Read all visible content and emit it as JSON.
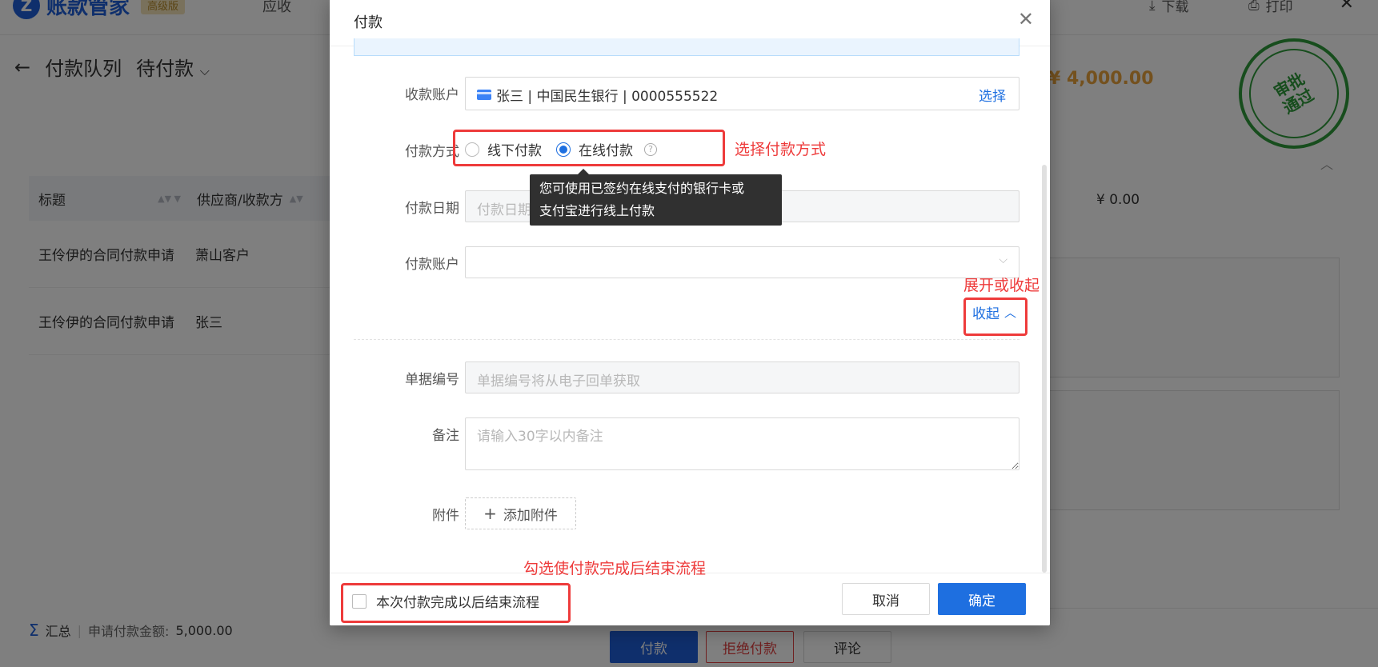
{
  "app": {
    "brand_name": "账款管家",
    "brand_badge": "高级版",
    "nav_item": "应收",
    "download_label": "下载",
    "print_label": "打印"
  },
  "page": {
    "crumb": "付款队列",
    "status_dropdown": "待付款",
    "amount": "¥ 4,000.00",
    "zero_amount": "¥ 0.00",
    "stamp_line1": "审批",
    "stamp_line2": "通过"
  },
  "table": {
    "headers": [
      "标题",
      "供应商/收款方"
    ],
    "rows": [
      [
        "王伶伊的合同付款申请",
        "萧山客户"
      ],
      [
        "王伶伊的合同付款申请",
        "张三"
      ]
    ]
  },
  "summary": {
    "label": "汇总",
    "amount_label": "申请付款金额:",
    "amount_value": "5,000.00"
  },
  "bottom_actions": {
    "pay": "付款",
    "reject": "拒绝付款",
    "comment": "评论"
  },
  "modal": {
    "title": "付款",
    "fields": {
      "payee_account_label": "收款账户",
      "payee_account_value": "张三 | 中国民生银行 | 0000555522",
      "payee_account_select": "选择",
      "method_label": "付款方式",
      "method_offline": "线下付款",
      "method_online": "在线付款",
      "method_selected": "在线付款",
      "date_label": "付款日期",
      "date_placeholder": "付款日期",
      "pay_account_label": "付款账户",
      "pay_account_value": "",
      "collapse_label": "收起",
      "doc_no_label": "单据编号",
      "doc_no_placeholder": "单据编号将从电子回单获取",
      "remark_label": "备注",
      "remark_placeholder": "请输入30字以内备注",
      "attach_label": "附件",
      "attach_button": "添加附件"
    },
    "tooltip": {
      "line1": "您可使用已签约在线支付的银行卡或",
      "line2": "支付宝进行线上付款"
    },
    "footer": {
      "end_flow_checkbox": "本次付款完成以后结束流程",
      "cancel": "取消",
      "confirm": "确定"
    }
  },
  "annotations": {
    "method_note": "选择付款方式",
    "collapse_note": "展开或收起",
    "end_flow_note": "勾选使付款完成后结束流程"
  },
  "colors": {
    "primary": "#1e6fe0",
    "annotation": "#ee3b3b",
    "stamp": "#2e9b3b",
    "amount": "#e8a33d"
  }
}
